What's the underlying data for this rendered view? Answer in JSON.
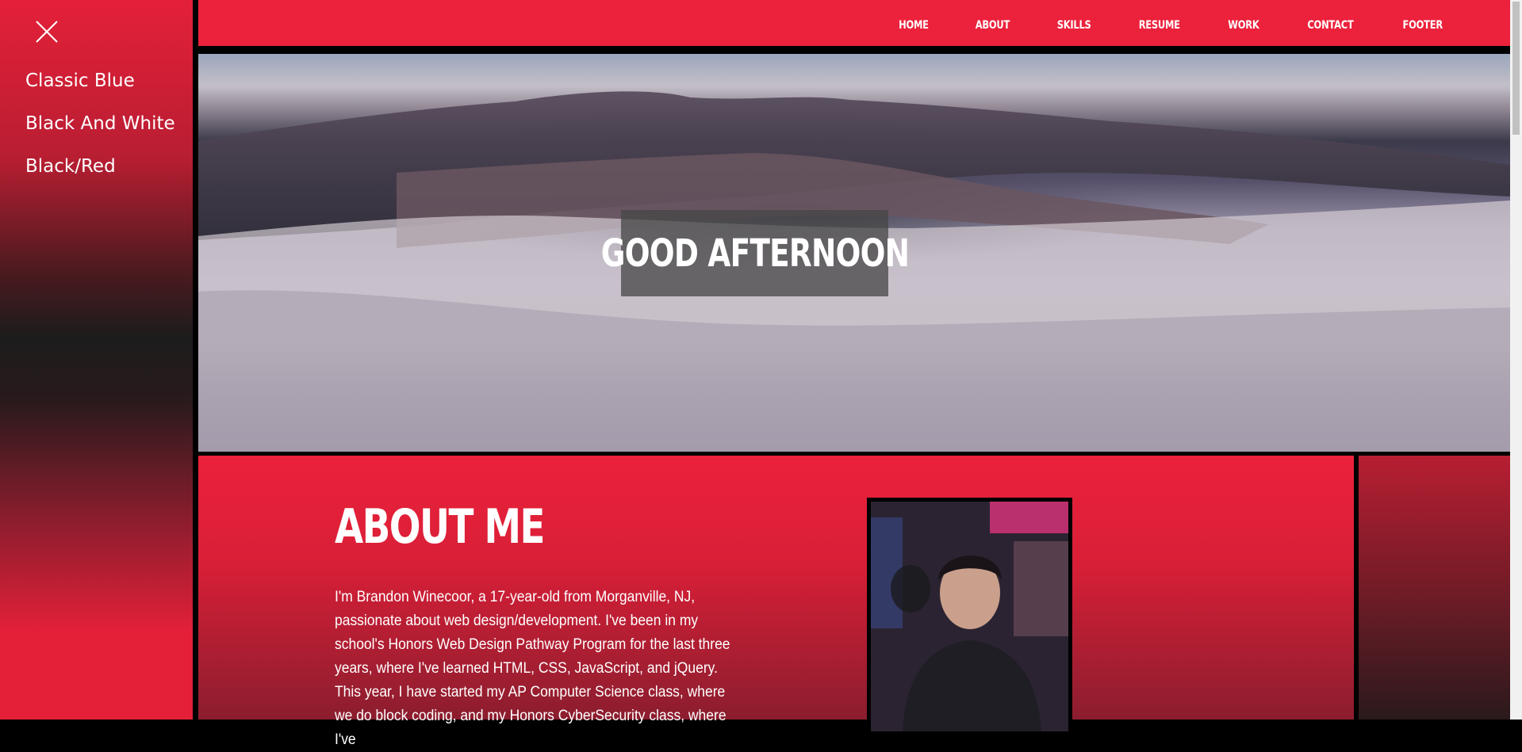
{
  "sidebar": {
    "close_icon": "close-icon",
    "themes": [
      "Classic Blue",
      "Black And White",
      "Black/Red"
    ]
  },
  "nav": {
    "links": [
      "HOME",
      "ABOUT",
      "SKILLS",
      "RESUME",
      "WORK",
      "CONTACT",
      "FOOTER"
    ]
  },
  "hero": {
    "greeting": "GOOD AFTERNOON"
  },
  "about": {
    "title": "ABOUT ME",
    "text": "I'm Brandon Winecoor, a 17-year-old from Morganville, NJ, passionate about web design/development. I've been in my school's Honors Web Design Pathway Program for the last three years, where I've learned HTML, CSS, JavaScript, and jQuery. This year, I have started my AP Computer Science class, where we do block coding, and my Honors CyberSecurity class, where I've"
  },
  "colors": {
    "accent_red": "#ec213b",
    "separator": "#000000",
    "text": "#ffffff"
  }
}
